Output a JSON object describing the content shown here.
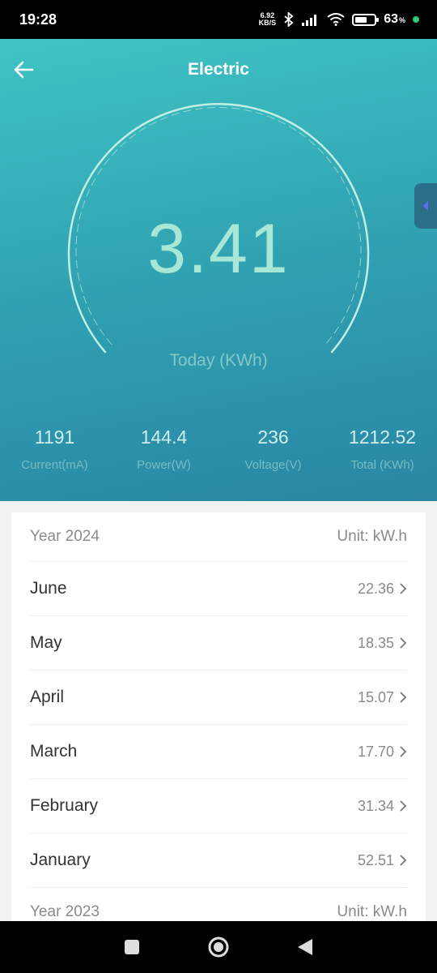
{
  "status_bar": {
    "time": "19:28",
    "net_speed_value": "6.92",
    "net_speed_unit": "KB/S",
    "battery_percent": "63",
    "battery_unit": "%",
    "battery_level": 0.63,
    "icons": [
      "bluetooth-icon",
      "signal-icon",
      "wifi-icon",
      "battery-icon"
    ]
  },
  "header": {
    "title": "Electric",
    "back_icon": "back-arrow-icon"
  },
  "gauge": {
    "value": "3.41",
    "label": "Today (KWh)"
  },
  "stats": [
    {
      "value": "1191",
      "label": "Current(mA)"
    },
    {
      "value": "144.4",
      "label": "Power(W)"
    },
    {
      "value": "236",
      "label": "Voltage(V)"
    },
    {
      "value": "1212.52",
      "label": "Total (KWh)"
    }
  ],
  "history": {
    "year_2024": {
      "year": "Year 2024",
      "unit": "Unit: kW.h"
    },
    "months": [
      {
        "name": "June",
        "value": "22.36"
      },
      {
        "name": "May",
        "value": "18.35"
      },
      {
        "name": "April",
        "value": "15.07"
      },
      {
        "name": "March",
        "value": "17.70"
      },
      {
        "name": "February",
        "value": "31.34"
      },
      {
        "name": "January",
        "value": "52.51"
      }
    ],
    "year_2023": {
      "year": "Year 2023",
      "unit": "Unit: kW.h"
    }
  },
  "colors": {
    "hero_top": "#3fc4c4",
    "hero_bottom": "#2a86a4",
    "gauge_value": "#a8e6d6"
  }
}
